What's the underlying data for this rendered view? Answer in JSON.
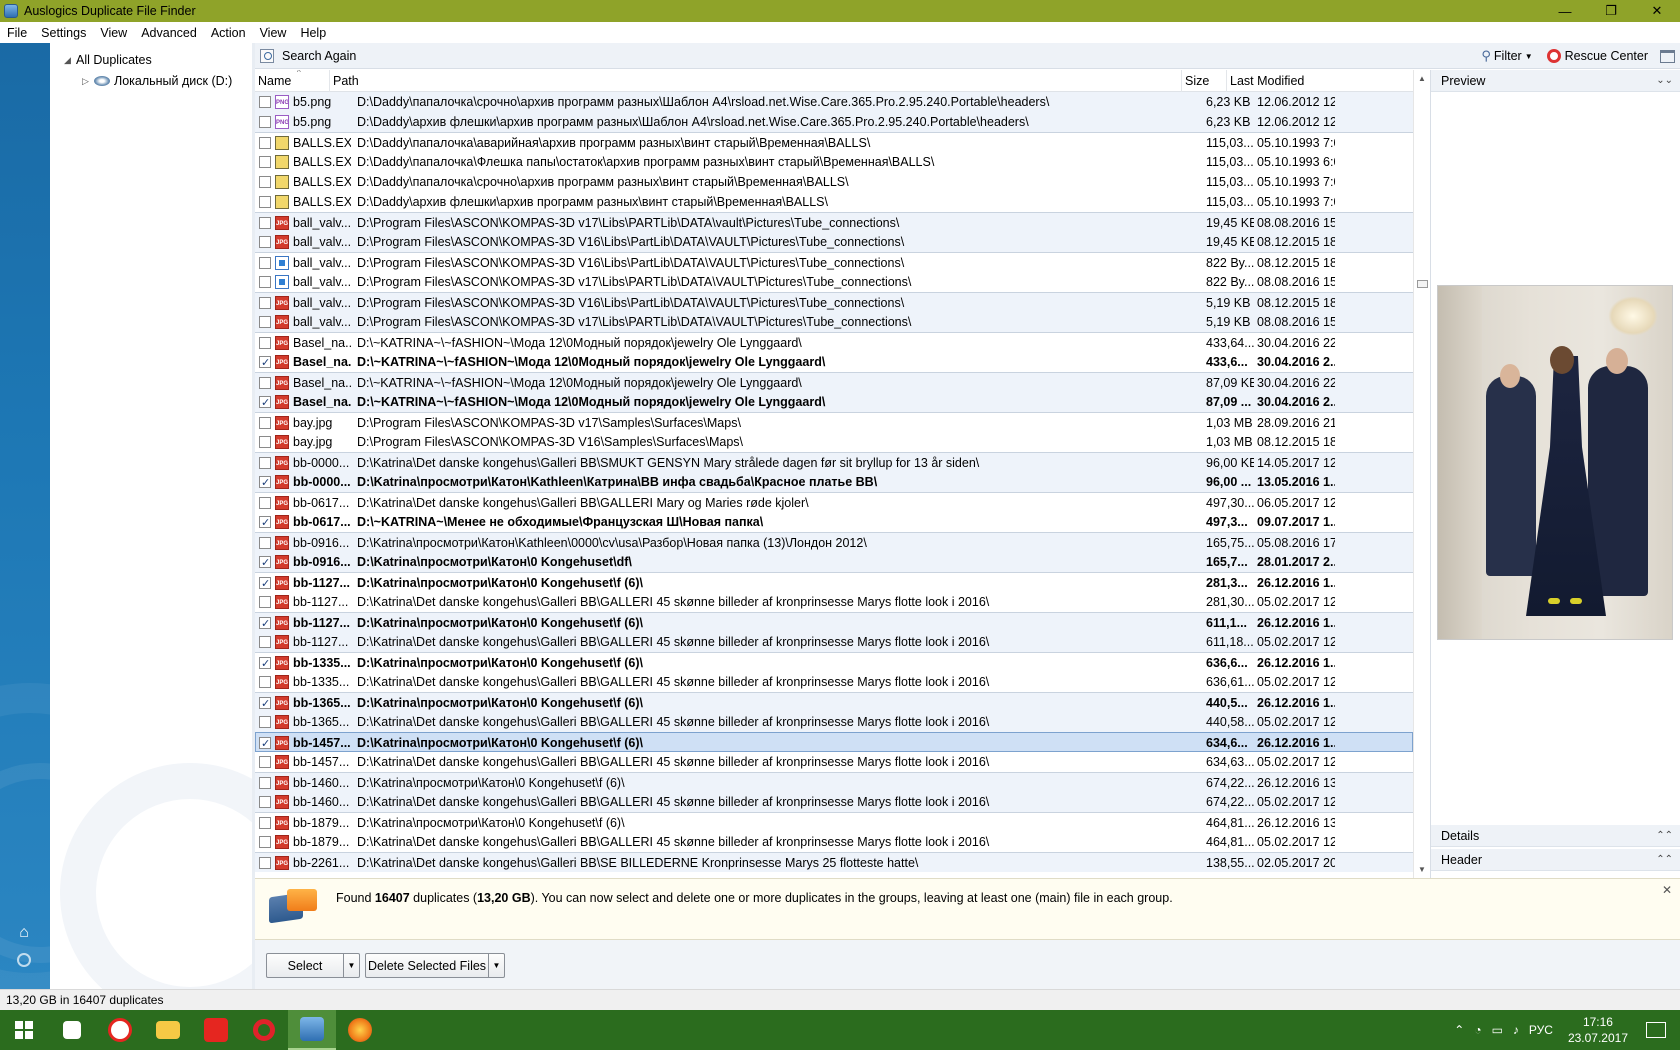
{
  "window": {
    "title": "Auslogics Duplicate File Finder"
  },
  "menu": [
    "File",
    "Settings",
    "View",
    "Advanced",
    "Action",
    "View",
    "Help"
  ],
  "tree": {
    "root": "All Duplicates",
    "child": "Локальный диск (D:)"
  },
  "toolbar": {
    "search_again": "Search Again",
    "filter": "Filter",
    "rescue_center": "Rescue Center"
  },
  "columns": {
    "name": "Name",
    "path": "Path",
    "size": "Size",
    "modified": "Last Modified"
  },
  "rows": [
    {
      "n": "b5.png",
      "p": "D:\\Daddy\\папалочка\\срочно\\архив программ разных\\Шаблон А4\\rsload.net.Wise.Care.365.Pro.2.95.240.Portable\\headers\\",
      "s": "6,23 KB",
      "d": "12.06.2012 12:...",
      "c": false,
      "i": "png"
    },
    {
      "n": "b5.png",
      "p": "D:\\Daddy\\архив флешки\\архив программ разных\\Шаблон А4\\rsload.net.Wise.Care.365.Pro.2.95.240.Portable\\headers\\",
      "s": "6,23 KB",
      "d": "12.06.2012 12:...",
      "c": false,
      "i": "png"
    },
    {
      "n": "BALLS.EXE",
      "p": "D:\\Daddy\\папалочка\\аварийная\\архив программ разных\\винт старый\\Временная\\BALLS\\",
      "s": "115,03...",
      "d": "05.10.1993 7:0...",
      "c": false,
      "i": "exe"
    },
    {
      "n": "BALLS.EXE",
      "p": "D:\\Daddy\\папалочка\\Флешка папы\\остаток\\архив программ разных\\винт старый\\Временная\\BALLS\\",
      "s": "115,03...",
      "d": "05.10.1993 6:0...",
      "c": false,
      "i": "exe"
    },
    {
      "n": "BALLS.EXE",
      "p": "D:\\Daddy\\папалочка\\срочно\\архив программ разных\\винт старый\\Временная\\BALLS\\",
      "s": "115,03...",
      "d": "05.10.1993 7:0...",
      "c": false,
      "i": "exe"
    },
    {
      "n": "BALLS.EXE",
      "p": "D:\\Daddy\\архив флешки\\архив программ разных\\винт старый\\Временная\\BALLS\\",
      "s": "115,03...",
      "d": "05.10.1993 7:0...",
      "c": false,
      "i": "exe"
    },
    {
      "n": "ball_valv...",
      "p": "D:\\Program Files\\ASCON\\KOMPAS-3D v17\\Libs\\PARTLib\\DATA\\vault\\Pictures\\Tube_connections\\",
      "s": "19,45 KB",
      "d": "08.08.2016 15:...",
      "c": false,
      "i": "jpg"
    },
    {
      "n": "ball_valv...",
      "p": "D:\\Program Files\\ASCON\\KOMPAS-3D V16\\Libs\\PartLib\\DATA\\VAULT\\Pictures\\Tube_connections\\",
      "s": "19,45 KB",
      "d": "08.12.2015 18:...",
      "c": false,
      "i": "jpg"
    },
    {
      "n": "ball_valv...",
      "p": "D:\\Program Files\\ASCON\\KOMPAS-3D V16\\Libs\\PartLib\\DATA\\VAULT\\Pictures\\Tube_connections\\",
      "s": "822 By...",
      "d": "08.12.2015 18:...",
      "c": false,
      "i": "img"
    },
    {
      "n": "ball_valv...",
      "p": "D:\\Program Files\\ASCON\\KOMPAS-3D v17\\Libs\\PARTLib\\DATA\\VAULT\\Pictures\\Tube_connections\\",
      "s": "822 By...",
      "d": "08.08.2016 15:...",
      "c": false,
      "i": "img"
    },
    {
      "n": "ball_valv...",
      "p": "D:\\Program Files\\ASCON\\KOMPAS-3D V16\\Libs\\PartLib\\DATA\\VAULT\\Pictures\\Tube_connections\\",
      "s": "5,19 KB",
      "d": "08.12.2015 18:...",
      "c": false,
      "i": "jpg"
    },
    {
      "n": "ball_valv...",
      "p": "D:\\Program Files\\ASCON\\KOMPAS-3D v17\\Libs\\PARTLib\\DATA\\VAULT\\Pictures\\Tube_connections\\",
      "s": "5,19 KB",
      "d": "08.08.2016 15:...",
      "c": false,
      "i": "jpg"
    },
    {
      "n": "Basel_na...",
      "p": "D:\\~KATRINA~\\~fASHION~\\Мода 12\\0Модный порядок\\jewelry Ole Lynggaard\\",
      "s": "433,64...",
      "d": "30.04.2016 22:...",
      "c": false,
      "i": "jpg"
    },
    {
      "n": "Basel_na...",
      "p": "D:\\~KATRINA~\\~fASHION~\\Мода 12\\0Модный порядок\\jewelry Ole Lynggaard\\",
      "s": "433,6...",
      "d": "30.04.2016 2...",
      "c": true,
      "i": "jpg"
    },
    {
      "n": "Basel_na...",
      "p": "D:\\~KATRINA~\\~fASHION~\\Мода 12\\0Модный порядок\\jewelry Ole Lynggaard\\",
      "s": "87,09 KB",
      "d": "30.04.2016 22:...",
      "c": false,
      "i": "jpg"
    },
    {
      "n": "Basel_na...",
      "p": "D:\\~KATRINA~\\~fASHION~\\Мода 12\\0Модный порядок\\jewelry Ole Lynggaard\\",
      "s": "87,09 ...",
      "d": "30.04.2016 2...",
      "c": true,
      "i": "jpg"
    },
    {
      "n": "bay.jpg",
      "p": "D:\\Program Files\\ASCON\\KOMPAS-3D v17\\Samples\\Surfaces\\Maps\\",
      "s": "1,03 MB",
      "d": "28.09.2016 21:...",
      "c": false,
      "i": "jpg"
    },
    {
      "n": "bay.jpg",
      "p": "D:\\Program Files\\ASCON\\KOMPAS-3D V16\\Samples\\Surfaces\\Maps\\",
      "s": "1,03 MB",
      "d": "08.12.2015 18:...",
      "c": false,
      "i": "jpg"
    },
    {
      "n": "bb-0000...",
      "p": "D:\\Katrina\\Det danske kongehus\\Galleri BB\\SMUKT GENSYN Mary strålede dagen før sit bryllup for 13 år siden\\",
      "s": "96,00 KB",
      "d": "14.05.2017 12:...",
      "c": false,
      "i": "jpg"
    },
    {
      "n": "bb-0000...",
      "p": "D:\\Katrina\\просмотри\\Катон\\Kathleen\\Катрина\\ВВ инфа свадьба\\Красное платье ВВ\\",
      "s": "96,00 ...",
      "d": "13.05.2016 1...",
      "c": true,
      "i": "jpg"
    },
    {
      "n": "bb-0617...",
      "p": "D:\\Katrina\\Det danske kongehus\\Galleri BB\\GALLERI Mary og Maries røde kjoler\\",
      "s": "497,30...",
      "d": "06.05.2017 12:...",
      "c": false,
      "i": "jpg"
    },
    {
      "n": "bb-0617...",
      "p": "D:\\~KATRINA~\\Менее не обходимые\\Французская Ш\\Новая папка\\",
      "s": "497,3...",
      "d": "09.07.2017 1...",
      "c": true,
      "i": "jpg"
    },
    {
      "n": "bb-0916...",
      "p": "D:\\Katrina\\просмотри\\Катон\\Kathleen\\0000\\cv\\usa\\Разбор\\Новая папка (13)\\Лондон 2012\\",
      "s": "165,75...",
      "d": "05.08.2016 17:...",
      "c": false,
      "i": "jpg"
    },
    {
      "n": "bb-0916...",
      "p": "D:\\Katrina\\просмотри\\Катон\\0 Kongehuset\\df\\",
      "s": "165,7...",
      "d": "28.01.2017 2...",
      "c": true,
      "i": "jpg"
    },
    {
      "n": "bb-1127...",
      "p": "D:\\Katrina\\просмотри\\Катон\\0 Kongehuset\\f (6)\\",
      "s": "281,3...",
      "d": "26.12.2016 1...",
      "c": true,
      "i": "jpg"
    },
    {
      "n": "bb-1127...",
      "p": "D:\\Katrina\\Det danske kongehus\\Galleri BB\\GALLERI 45 skønne billeder af kronprinsesse Marys flotte look i 2016\\",
      "s": "281,30...",
      "d": "05.02.2017 12:...",
      "c": false,
      "i": "jpg"
    },
    {
      "n": "bb-1127...",
      "p": "D:\\Katrina\\просмотри\\Катон\\0 Kongehuset\\f (6)\\",
      "s": "611,1...",
      "d": "26.12.2016 1...",
      "c": true,
      "i": "jpg"
    },
    {
      "n": "bb-1127...",
      "p": "D:\\Katrina\\Det danske kongehus\\Galleri BB\\GALLERI 45 skønne billeder af kronprinsesse Marys flotte look i 2016\\",
      "s": "611,18...",
      "d": "05.02.2017 12:...",
      "c": false,
      "i": "jpg"
    },
    {
      "n": "bb-1335...",
      "p": "D:\\Katrina\\просмотри\\Катон\\0 Kongehuset\\f (6)\\",
      "s": "636,6...",
      "d": "26.12.2016 1...",
      "c": true,
      "i": "jpg"
    },
    {
      "n": "bb-1335...",
      "p": "D:\\Katrina\\Det danske kongehus\\Galleri BB\\GALLERI 45 skønne billeder af kronprinsesse Marys flotte look i 2016\\",
      "s": "636,61...",
      "d": "05.02.2017 12:...",
      "c": false,
      "i": "jpg"
    },
    {
      "n": "bb-1365...",
      "p": "D:\\Katrina\\просмотри\\Катон\\0 Kongehuset\\f (6)\\",
      "s": "440,5...",
      "d": "26.12.2016 1...",
      "c": true,
      "i": "jpg"
    },
    {
      "n": "bb-1365...",
      "p": "D:\\Katrina\\Det danske kongehus\\Galleri BB\\GALLERI 45 skønne billeder af kronprinsesse Marys flotte look i 2016\\",
      "s": "440,58...",
      "d": "05.02.2017 12:...",
      "c": false,
      "i": "jpg"
    },
    {
      "n": "bb-1457...",
      "p": "D:\\Katrina\\просмотри\\Катон\\0 Kongehuset\\f (6)\\",
      "s": "634,6...",
      "d": "26.12.2016 1...",
      "c": true,
      "i": "jpg"
    },
    {
      "n": "bb-1457...",
      "p": "D:\\Katrina\\Det danske kongehus\\Galleri BB\\GALLERI 45 skønne billeder af kronprinsesse Marys flotte look i 2016\\",
      "s": "634,63...",
      "d": "05.02.2017 12:...",
      "c": false,
      "i": "jpg"
    },
    {
      "n": "bb-1460...",
      "p": "D:\\Katrina\\просмотри\\Катон\\0 Kongehuset\\f (6)\\",
      "s": "674,22...",
      "d": "26.12.2016 13:...",
      "c": false,
      "i": "jpg"
    },
    {
      "n": "bb-1460...",
      "p": "D:\\Katrina\\Det danske kongehus\\Galleri BB\\GALLERI 45 skønne billeder af kronprinsesse Marys flotte look i 2016\\",
      "s": "674,22...",
      "d": "05.02.2017 12:...",
      "c": false,
      "i": "jpg"
    },
    {
      "n": "bb-1879...",
      "p": "D:\\Katrina\\просмотри\\Катон\\0 Kongehuset\\f (6)\\",
      "s": "464,81...",
      "d": "26.12.2016 13:...",
      "c": false,
      "i": "jpg"
    },
    {
      "n": "bb-1879...",
      "p": "D:\\Katrina\\Det danske kongehus\\Galleri BB\\GALLERI 45 skønne billeder af kronprinsesse Marys flotte look i 2016\\",
      "s": "464,81...",
      "d": "05.02.2017 12:...",
      "c": false,
      "i": "jpg"
    },
    {
      "n": "bb-2261...",
      "p": "D:\\Katrina\\Det danske kongehus\\Galleri BB\\SE BILLEDERNE Kronprinsesse Marys 25 flotteste hatte\\",
      "s": "138,55...",
      "d": "02.05.2017 20:...",
      "c": false,
      "i": "jpg"
    }
  ],
  "preview": {
    "title": "Preview",
    "details": "Details",
    "header": "Header"
  },
  "info": {
    "pre": "Found ",
    "count": "16407",
    "mid": " duplicates (",
    "size": "13,20 GB",
    "post": "). You can now select and delete one or more duplicates in the groups, leaving at least one (main) file in each group."
  },
  "buttons": {
    "select": "Select",
    "delete": "Delete Selected Files"
  },
  "status": "13,20 GB in 16407 duplicates",
  "tray": {
    "lang": "РУС",
    "time": "17:16",
    "date": "23.07.2017"
  }
}
